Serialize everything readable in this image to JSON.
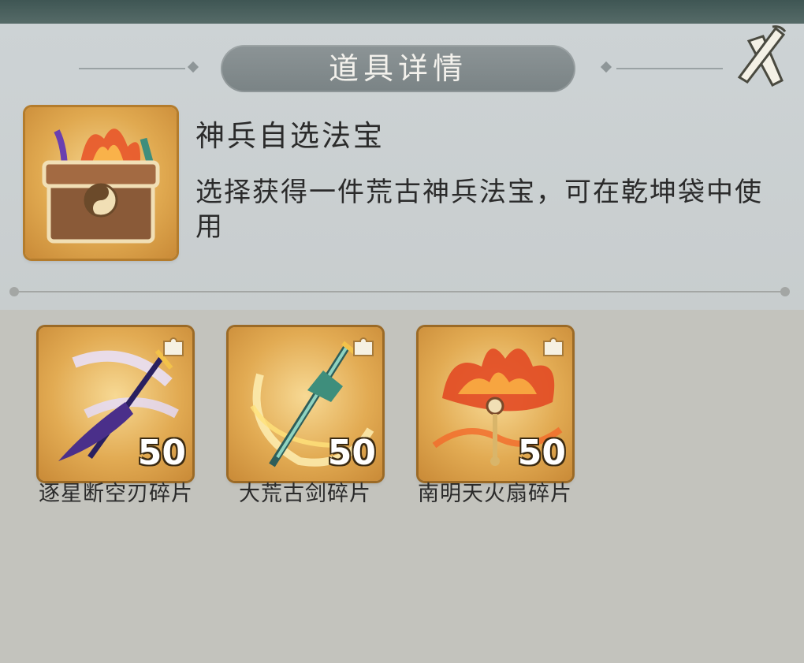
{
  "dialog": {
    "title": "道具详情",
    "close_icon": "close-x-icon"
  },
  "item": {
    "name": "神兵自选法宝",
    "description": "选择获得一件荒古神兵法宝，可在乾坤袋中使用",
    "icon": "treasure-chest-icon"
  },
  "rewards": [
    {
      "label": "逐星断空刃碎片",
      "count": "50",
      "icon": "purple-blade-icon"
    },
    {
      "label": "大荒古剑碎片",
      "count": "50",
      "icon": "jade-sword-icon"
    },
    {
      "label": "南明天火扇碎片",
      "count": "50",
      "icon": "fire-fan-icon"
    }
  ],
  "colors": {
    "frame_gold": "#e2ab53",
    "title_pill": "#7a8385",
    "panel_bg": "#cdd3d5"
  }
}
